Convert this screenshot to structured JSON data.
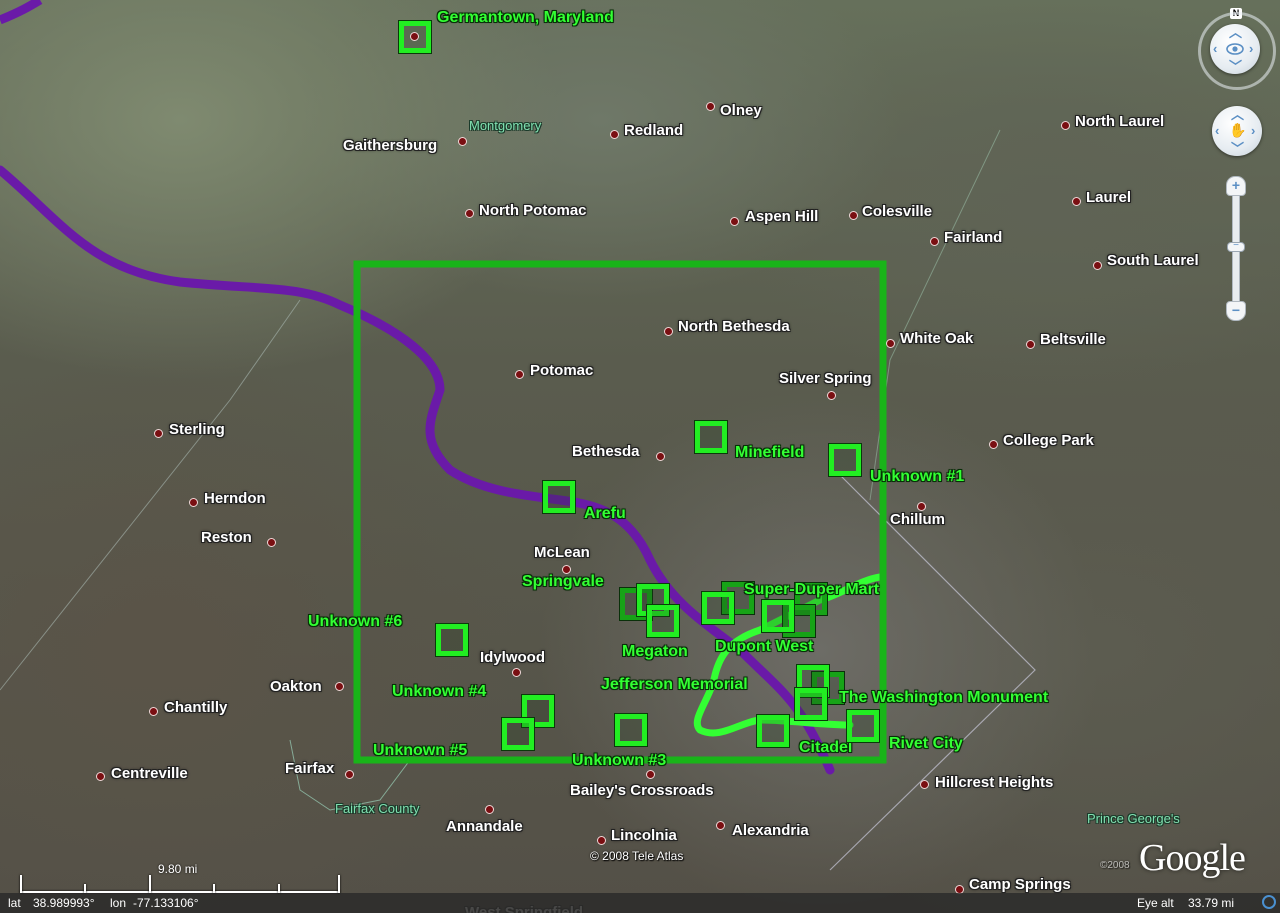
{
  "app": "Google Earth",
  "map": {
    "colors": {
      "overlay_box": "#19b419",
      "marker": "#22ee22",
      "marker_dark": "#17a317",
      "marker_label": "#33ff33",
      "river_path": "#6a1aa8",
      "route_path": "#33ff33",
      "place_dot": "#7a0f12"
    },
    "places": [
      {
        "name": "Gaithersburg"
      },
      {
        "name": "Redland"
      },
      {
        "name": "Olney"
      },
      {
        "name": "North Potomac"
      },
      {
        "name": "Aspen Hill"
      },
      {
        "name": "Colesville"
      },
      {
        "name": "Fairland"
      },
      {
        "name": "North Laurel"
      },
      {
        "name": "Laurel"
      },
      {
        "name": "South Laurel"
      },
      {
        "name": "North Bethesda"
      },
      {
        "name": "White Oak"
      },
      {
        "name": "Beltsville"
      },
      {
        "name": "Potomac"
      },
      {
        "name": "Silver Spring"
      },
      {
        "name": "College Park"
      },
      {
        "name": "Bethesda"
      },
      {
        "name": "Chillum"
      },
      {
        "name": "McLean"
      },
      {
        "name": "Sterling"
      },
      {
        "name": "Herndon"
      },
      {
        "name": "Reston"
      },
      {
        "name": "Idylwood"
      },
      {
        "name": "Oakton"
      },
      {
        "name": "Chantilly"
      },
      {
        "name": "Centreville"
      },
      {
        "name": "Fairfax"
      },
      {
        "name": "Annandale"
      },
      {
        "name": "Bailey's Crossroads"
      },
      {
        "name": "Lincolnia"
      },
      {
        "name": "Alexandria"
      },
      {
        "name": "Hillcrest Heights"
      },
      {
        "name": "Camp Springs"
      },
      {
        "name": "West Springfield"
      }
    ],
    "regions": [
      {
        "name": "Montgomery"
      },
      {
        "name": "Fairfax County"
      },
      {
        "name": "Prince George's"
      }
    ],
    "markers": [
      {
        "label": "Germantown, Maryland"
      },
      {
        "label": "Minefield"
      },
      {
        "label": "Unknown #1"
      },
      {
        "label": "Arefu"
      },
      {
        "label": "Springvale"
      },
      {
        "label": "Super-Duper Mart"
      },
      {
        "label": "Unknown #6"
      },
      {
        "label": "Megaton"
      },
      {
        "label": "Dupont West"
      },
      {
        "label": "Jefferson Memorial"
      },
      {
        "label": "Unknown #4"
      },
      {
        "label": "The Washington Monument"
      },
      {
        "label": "Unknown #5"
      },
      {
        "label": "Unknown #3"
      },
      {
        "label": "Citadel"
      },
      {
        "label": "Rivet City"
      }
    ],
    "copyright": "© 2008 Tele Atlas",
    "google_logo": "Google",
    "google_small_copyright": "©2008"
  },
  "scale": {
    "label": "9.80 mi"
  },
  "status": {
    "lat_label": "lat",
    "lat_value": "38.989993°",
    "lon_label": "lon",
    "lon_value": "-77.133106°",
    "eye_alt_label": "Eye alt",
    "eye_alt_value": "33.79 mi"
  },
  "nav": {
    "north_label": "N",
    "zoom_in": "+",
    "zoom_out": "−",
    "zoom_thumb": "−",
    "look_icon": "eye-icon",
    "move_icon": "hand-icon"
  }
}
